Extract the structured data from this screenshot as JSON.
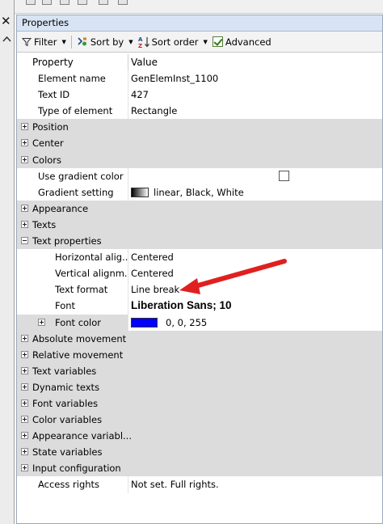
{
  "panel": {
    "title": "Properties"
  },
  "toolbar": {
    "filter_label": "Filter",
    "sortby_label": "Sort by",
    "sortorder_label": "Sort order",
    "advanced_label": "Advanced",
    "advanced_checked": true
  },
  "columns": {
    "property": "Property",
    "value": "Value"
  },
  "rows": {
    "element_name": {
      "label": "Element name",
      "value": "GenElemInst_1100"
    },
    "text_id": {
      "label": "Text ID",
      "value": "427"
    },
    "type_of_element": {
      "label": "Type of element",
      "value": "Rectangle"
    },
    "position": {
      "label": "Position"
    },
    "center": {
      "label": "Center"
    },
    "colors": {
      "label": "Colors"
    },
    "use_gradient": {
      "label": "Use gradient color",
      "checked": false
    },
    "gradient_setting": {
      "label": "Gradient setting",
      "value": "linear, Black, White"
    },
    "appearance": {
      "label": "Appearance"
    },
    "texts": {
      "label": "Texts"
    },
    "text_properties": {
      "label": "Text properties"
    },
    "horizontal_alignment": {
      "label": "Horizontal alig...",
      "value": "Centered"
    },
    "vertical_alignment": {
      "label": "Vertical alignm...",
      "value": "Centered"
    },
    "text_format": {
      "label": "Text format",
      "value": "Line break"
    },
    "font": {
      "label": "Font",
      "value": "Liberation Sans; 10"
    },
    "font_color": {
      "label": "Font color",
      "value": "0, 0, 255",
      "color": "#0000ff"
    },
    "absolute_movement": {
      "label": "Absolute movement"
    },
    "relative_movement": {
      "label": "Relative movement"
    },
    "text_variables": {
      "label": "Text variables"
    },
    "dynamic_texts": {
      "label": "Dynamic texts"
    },
    "font_variables": {
      "label": "Font variables"
    },
    "color_variables": {
      "label": "Color variables"
    },
    "appearance_variables": {
      "label": "Appearance variabl..."
    },
    "state_variables": {
      "label": "State variables"
    },
    "input_configuration": {
      "label": "Input configuration"
    },
    "access_rights": {
      "label": "Access rights",
      "value": "Not set. Full rights."
    }
  },
  "colors": {
    "category_bg": "#dcdcdc",
    "title_bg": "#d8e4f4",
    "annotation_arrow": "#e02020"
  }
}
